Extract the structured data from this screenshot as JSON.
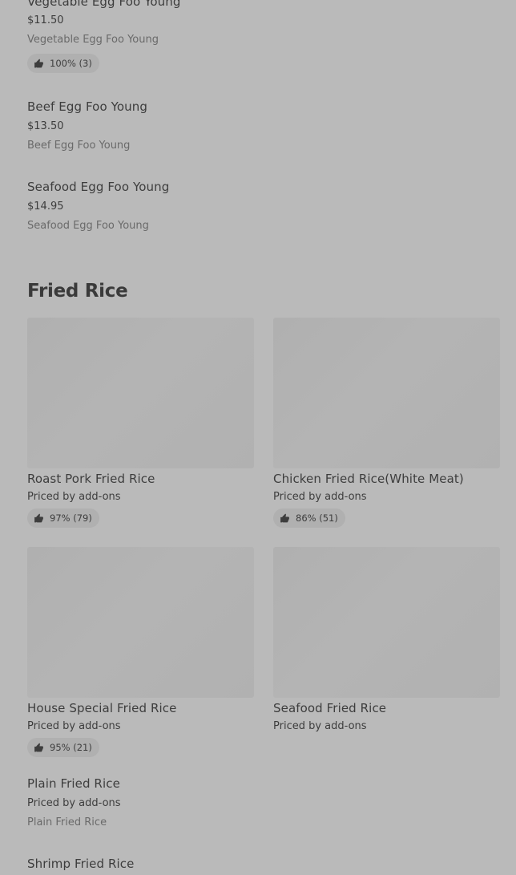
{
  "egg_foo_young": {
    "items": [
      {
        "name": "Vegetable Egg Foo Young",
        "price": "$11.50",
        "description": "Vegetable Egg Foo Young",
        "rating": "100% (3)"
      },
      {
        "name": "Beef Egg Foo Young",
        "price": "$13.50",
        "description": "Beef Egg Foo Young"
      },
      {
        "name": "Seafood Egg Foo Young",
        "price": "$14.95",
        "description": "Seafood Egg Foo Young"
      }
    ]
  },
  "fried_rice": {
    "title": "Fried Rice",
    "cards": [
      {
        "name": "Roast Pork Fried Rice",
        "price": "Priced by add-ons",
        "rating": "97% (79)"
      },
      {
        "name": "Chicken Fried Rice(White Meat)",
        "price": "Priced by add-ons",
        "rating": "86% (51)"
      },
      {
        "name": "House Special Fried Rice",
        "price": "Priced by add-ons",
        "rating": "95% (21)"
      },
      {
        "name": "Seafood Fried Rice",
        "price": "Priced by add-ons"
      }
    ],
    "list_items": [
      {
        "name": "Plain Fried Rice",
        "price": "Priced by add-ons",
        "description": "Plain Fried Rice"
      },
      {
        "name": "Shrimp Fried Rice"
      }
    ]
  },
  "icons": {
    "thumbs_up": "thumbs-up-icon"
  }
}
